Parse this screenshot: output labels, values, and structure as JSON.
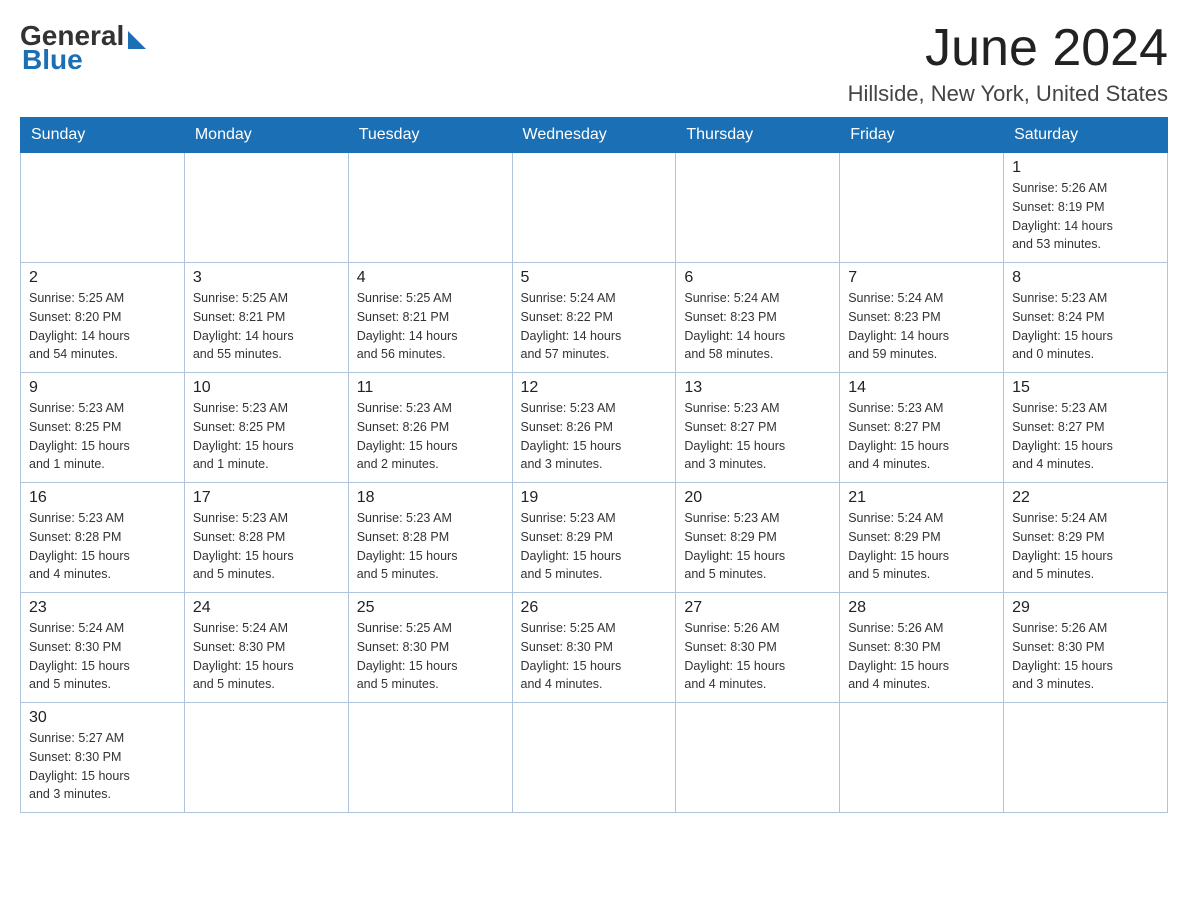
{
  "header": {
    "logo": {
      "general": "General",
      "blue": "Blue"
    },
    "month": "June 2024",
    "location": "Hillside, New York, United States"
  },
  "weekdays": [
    "Sunday",
    "Monday",
    "Tuesday",
    "Wednesday",
    "Thursday",
    "Friday",
    "Saturday"
  ],
  "weeks": [
    [
      {
        "day": "",
        "info": ""
      },
      {
        "day": "",
        "info": ""
      },
      {
        "day": "",
        "info": ""
      },
      {
        "day": "",
        "info": ""
      },
      {
        "day": "",
        "info": ""
      },
      {
        "day": "",
        "info": ""
      },
      {
        "day": "1",
        "info": "Sunrise: 5:26 AM\nSunset: 8:19 PM\nDaylight: 14 hours\nand 53 minutes."
      }
    ],
    [
      {
        "day": "2",
        "info": "Sunrise: 5:25 AM\nSunset: 8:20 PM\nDaylight: 14 hours\nand 54 minutes."
      },
      {
        "day": "3",
        "info": "Sunrise: 5:25 AM\nSunset: 8:21 PM\nDaylight: 14 hours\nand 55 minutes."
      },
      {
        "day": "4",
        "info": "Sunrise: 5:25 AM\nSunset: 8:21 PM\nDaylight: 14 hours\nand 56 minutes."
      },
      {
        "day": "5",
        "info": "Sunrise: 5:24 AM\nSunset: 8:22 PM\nDaylight: 14 hours\nand 57 minutes."
      },
      {
        "day": "6",
        "info": "Sunrise: 5:24 AM\nSunset: 8:23 PM\nDaylight: 14 hours\nand 58 minutes."
      },
      {
        "day": "7",
        "info": "Sunrise: 5:24 AM\nSunset: 8:23 PM\nDaylight: 14 hours\nand 59 minutes."
      },
      {
        "day": "8",
        "info": "Sunrise: 5:23 AM\nSunset: 8:24 PM\nDaylight: 15 hours\nand 0 minutes."
      }
    ],
    [
      {
        "day": "9",
        "info": "Sunrise: 5:23 AM\nSunset: 8:25 PM\nDaylight: 15 hours\nand 1 minute."
      },
      {
        "day": "10",
        "info": "Sunrise: 5:23 AM\nSunset: 8:25 PM\nDaylight: 15 hours\nand 1 minute."
      },
      {
        "day": "11",
        "info": "Sunrise: 5:23 AM\nSunset: 8:26 PM\nDaylight: 15 hours\nand 2 minutes."
      },
      {
        "day": "12",
        "info": "Sunrise: 5:23 AM\nSunset: 8:26 PM\nDaylight: 15 hours\nand 3 minutes."
      },
      {
        "day": "13",
        "info": "Sunrise: 5:23 AM\nSunset: 8:27 PM\nDaylight: 15 hours\nand 3 minutes."
      },
      {
        "day": "14",
        "info": "Sunrise: 5:23 AM\nSunset: 8:27 PM\nDaylight: 15 hours\nand 4 minutes."
      },
      {
        "day": "15",
        "info": "Sunrise: 5:23 AM\nSunset: 8:27 PM\nDaylight: 15 hours\nand 4 minutes."
      }
    ],
    [
      {
        "day": "16",
        "info": "Sunrise: 5:23 AM\nSunset: 8:28 PM\nDaylight: 15 hours\nand 4 minutes."
      },
      {
        "day": "17",
        "info": "Sunrise: 5:23 AM\nSunset: 8:28 PM\nDaylight: 15 hours\nand 5 minutes."
      },
      {
        "day": "18",
        "info": "Sunrise: 5:23 AM\nSunset: 8:28 PM\nDaylight: 15 hours\nand 5 minutes."
      },
      {
        "day": "19",
        "info": "Sunrise: 5:23 AM\nSunset: 8:29 PM\nDaylight: 15 hours\nand 5 minutes."
      },
      {
        "day": "20",
        "info": "Sunrise: 5:23 AM\nSunset: 8:29 PM\nDaylight: 15 hours\nand 5 minutes."
      },
      {
        "day": "21",
        "info": "Sunrise: 5:24 AM\nSunset: 8:29 PM\nDaylight: 15 hours\nand 5 minutes."
      },
      {
        "day": "22",
        "info": "Sunrise: 5:24 AM\nSunset: 8:29 PM\nDaylight: 15 hours\nand 5 minutes."
      }
    ],
    [
      {
        "day": "23",
        "info": "Sunrise: 5:24 AM\nSunset: 8:30 PM\nDaylight: 15 hours\nand 5 minutes."
      },
      {
        "day": "24",
        "info": "Sunrise: 5:24 AM\nSunset: 8:30 PM\nDaylight: 15 hours\nand 5 minutes."
      },
      {
        "day": "25",
        "info": "Sunrise: 5:25 AM\nSunset: 8:30 PM\nDaylight: 15 hours\nand 5 minutes."
      },
      {
        "day": "26",
        "info": "Sunrise: 5:25 AM\nSunset: 8:30 PM\nDaylight: 15 hours\nand 4 minutes."
      },
      {
        "day": "27",
        "info": "Sunrise: 5:26 AM\nSunset: 8:30 PM\nDaylight: 15 hours\nand 4 minutes."
      },
      {
        "day": "28",
        "info": "Sunrise: 5:26 AM\nSunset: 8:30 PM\nDaylight: 15 hours\nand 4 minutes."
      },
      {
        "day": "29",
        "info": "Sunrise: 5:26 AM\nSunset: 8:30 PM\nDaylight: 15 hours\nand 3 minutes."
      }
    ],
    [
      {
        "day": "30",
        "info": "Sunrise: 5:27 AM\nSunset: 8:30 PM\nDaylight: 15 hours\nand 3 minutes."
      },
      {
        "day": "",
        "info": ""
      },
      {
        "day": "",
        "info": ""
      },
      {
        "day": "",
        "info": ""
      },
      {
        "day": "",
        "info": ""
      },
      {
        "day": "",
        "info": ""
      },
      {
        "day": "",
        "info": ""
      }
    ]
  ]
}
